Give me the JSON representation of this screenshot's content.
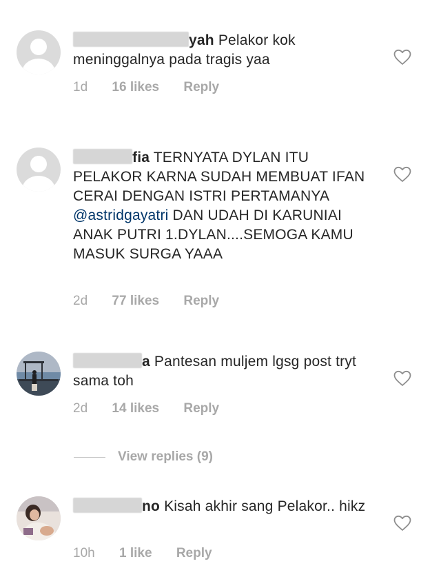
{
  "comments": [
    {
      "username_visible": "yah",
      "text": " Pelakor kok meninggalnya pada tragis yaa",
      "time": "1d",
      "likes": "16 likes",
      "reply": "Reply",
      "avatar": "default-avatar",
      "liked": false
    },
    {
      "username_visible": "fia",
      "text_before_mention": " TERNYATA DYLAN ITU PELAKOR KARNA SUDAH MEMBUAT IFAN CERAI DENGAN ISTRI PERTAMANYA ",
      "mention": "@astridgayatri",
      "text_after_mention": " DAN UDAH DI KARUNIAI ANAK PUTRI 1.DYLAN....SEMOGA KAMU MASUK SURGA YAAA",
      "time": "2d",
      "likes": "77 likes",
      "reply": "Reply",
      "avatar": "default-avatar",
      "liked": false
    },
    {
      "username_visible": "a",
      "text": " Pantesan muljem lgsg post tryt sama toh",
      "time": "2d",
      "likes": "14 likes",
      "reply": "Reply",
      "avatar": "photo-avatar-pier",
      "liked": false,
      "view_replies": "View replies (9)"
    },
    {
      "username_visible": "no",
      "text": " Kisah akhir sang Pelakor.. hikz",
      "time": "10h",
      "likes": "1 like",
      "reply": "Reply",
      "avatar": "photo-avatar-person",
      "liked": false
    }
  ],
  "colors": {
    "text": "#262626",
    "meta": "#a8a8a8",
    "mention": "#003569",
    "avatar_default": "#dbdbdb",
    "heart_outline": "#8e8e8e"
  }
}
